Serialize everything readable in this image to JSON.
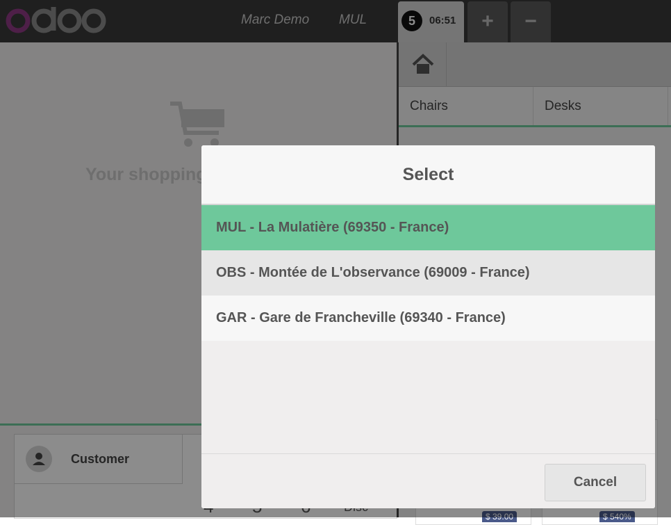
{
  "navbar": {
    "logo_text": "odoo",
    "user_name": "Marc Demo",
    "store_code": "MUL",
    "order": {
      "number": "5",
      "time": "06:51"
    },
    "add_order_label": "+",
    "remove_order_label": "−"
  },
  "order_pane": {
    "empty_message": "Your shopping cart is empty",
    "customer_label": "Customer",
    "numpad": [
      "4",
      "5",
      "6",
      "Disc"
    ]
  },
  "product_pane": {
    "categories": [
      "Chairs",
      "Desks"
    ],
    "price_tags": [
      "$ 39.00",
      "$ 540%"
    ]
  },
  "modal": {
    "title": "Select",
    "options": [
      "MUL - La Mulatière (69350 - France)",
      "OBS - Montée de L'observance (69009 - France)",
      "GAR - Gare de Francheville (69340 - France)"
    ],
    "cancel_label": "Cancel"
  },
  "colors": {
    "accent": "#6ec89b",
    "navbar": "#3a3a3a",
    "logo_purple": "#8f3a84",
    "logo_gray": "#8a8a8a"
  }
}
